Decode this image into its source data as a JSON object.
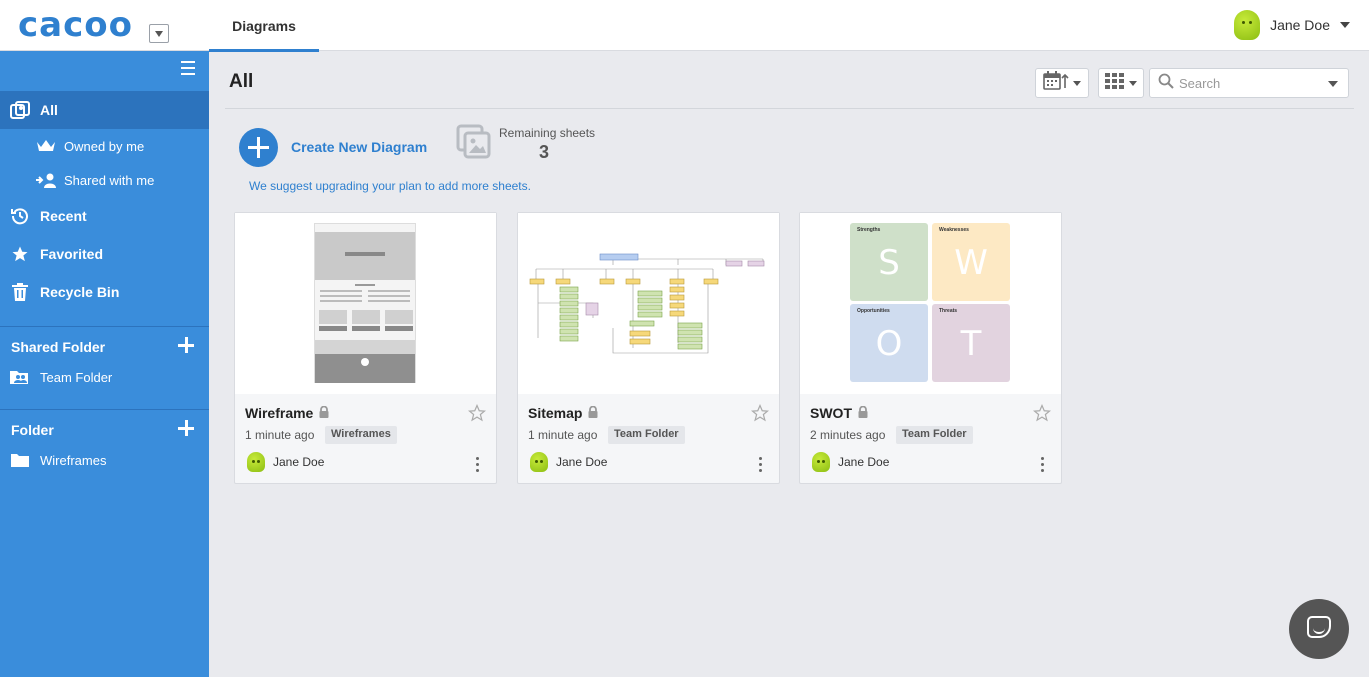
{
  "app": {
    "logo": "cacoo"
  },
  "header": {
    "nav_tab": "Diagrams",
    "user_name": "Jane Doe"
  },
  "sidebar": {
    "items": [
      {
        "label": "All"
      },
      {
        "label": "Owned by me"
      },
      {
        "label": "Shared with me"
      },
      {
        "label": "Recent"
      },
      {
        "label": "Favorited"
      },
      {
        "label": "Recycle Bin"
      }
    ],
    "shared_folder": {
      "heading": "Shared Folder",
      "items": [
        "Team Folder"
      ]
    },
    "folder": {
      "heading": "Folder",
      "items": [
        "Wireframes"
      ]
    }
  },
  "main": {
    "title": "All",
    "search": {
      "placeholder": "Search"
    },
    "create_label": "Create New Diagram",
    "remaining_label": "Remaining sheets",
    "remaining_count": "3",
    "upgrade_text": "We suggest upgrading your plan to add more sheets."
  },
  "cards": [
    {
      "title": "Wireframe",
      "time": "1 minute ago",
      "tag": "Wireframes",
      "owner": "Jane Doe"
    },
    {
      "title": "Sitemap",
      "time": "1 minute ago",
      "tag": "Team Folder",
      "owner": "Jane Doe"
    },
    {
      "title": "SWOT",
      "time": "2 minutes ago",
      "tag": "Team Folder",
      "owner": "Jane Doe",
      "swot": [
        {
          "heading": "Strengths",
          "letter": "S",
          "color": "#cfe0c9"
        },
        {
          "heading": "Weaknesses",
          "letter": "W",
          "color": "#fde9c4"
        },
        {
          "heading": "Opportunities",
          "letter": "O",
          "color": "#cfdcef"
        },
        {
          "heading": "Threats",
          "letter": "T",
          "color": "#e2d3df"
        }
      ]
    }
  ],
  "colors": {
    "accent": "#2f80cf",
    "sidebar": "#3a8ddb",
    "sidebar_active": "#2c73bd",
    "avatar": "#a6d21c"
  }
}
